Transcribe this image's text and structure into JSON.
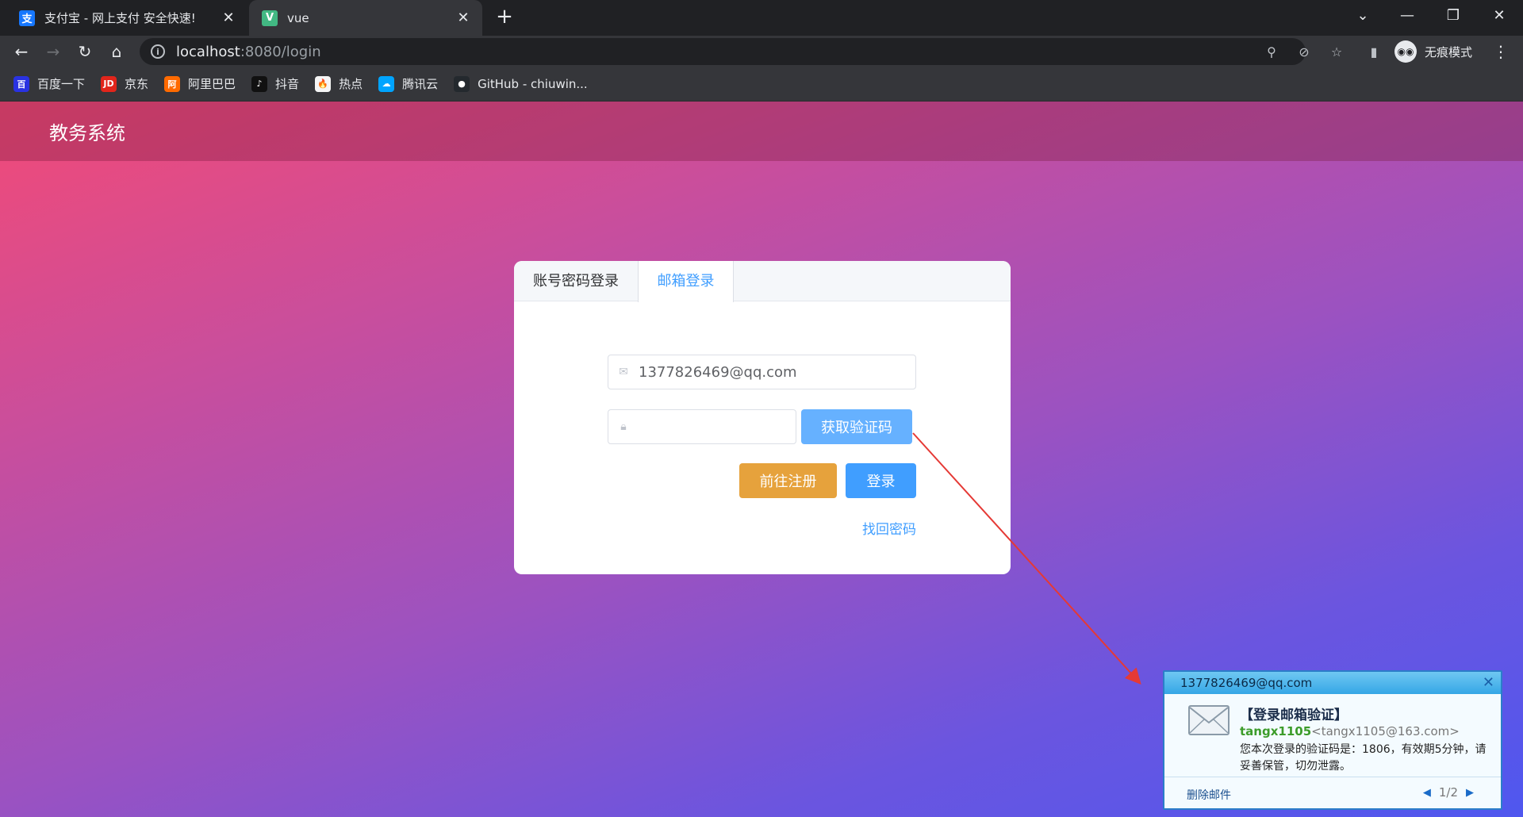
{
  "browser": {
    "tabs": [
      {
        "title": "支付宝 - 网上支付 安全快速!",
        "icon": "alipay-icon",
        "icon_glyph": "支",
        "icon_color": "#1677ff"
      },
      {
        "title": "vue",
        "icon": "vue-icon",
        "icon_glyph": "V",
        "icon_color": "#42b883"
      }
    ],
    "new_tab_glyph": "+",
    "address": {
      "host": "localhost",
      "port_path": ":8080/login"
    },
    "incognito_label": "无痕模式",
    "bookmarks": [
      {
        "label": "百度一下",
        "glyph": "百",
        "color": "#2932e1"
      },
      {
        "label": "京东",
        "glyph": "JD",
        "color": "#e1251b"
      },
      {
        "label": "阿里巴巴",
        "glyph": "阿",
        "color": "#ff6a00"
      },
      {
        "label": "抖音",
        "glyph": "♪",
        "color": "#111111"
      },
      {
        "label": "热点",
        "glyph": "🔥",
        "color": "#f5f5f5"
      },
      {
        "label": "腾讯云",
        "glyph": "☁",
        "color": "#00a4ff"
      },
      {
        "label": "GitHub - chiuwin...",
        "glyph": "●",
        "color": "#24292e"
      }
    ]
  },
  "app": {
    "brand": "教务系统"
  },
  "login": {
    "tabs": [
      "账号密码登录",
      "邮箱登录"
    ],
    "active_tab": "邮箱登录",
    "email_value": "1377826469@qq.com",
    "code_value": "",
    "get_code_label": "获取验证码",
    "register_label": "前往注册",
    "login_label": "登录",
    "forgot_label": "找回密码"
  },
  "mail_notification": {
    "account": "1377826469@qq.com",
    "subject": "【登录邮箱验证】",
    "sender_name": "tangx1105",
    "sender_address": "<tangx1105@163.com>",
    "body": "您本次登录的验证码是：1806，有效期5分钟，请妥善保管，切勿泄露。",
    "delete_label": "删除邮件",
    "pager": "1/2"
  },
  "colors": {
    "primary": "#409eff",
    "primary_light": "#66b1ff",
    "warning": "#e6a23c",
    "annotation_arrow": "#e53935"
  }
}
